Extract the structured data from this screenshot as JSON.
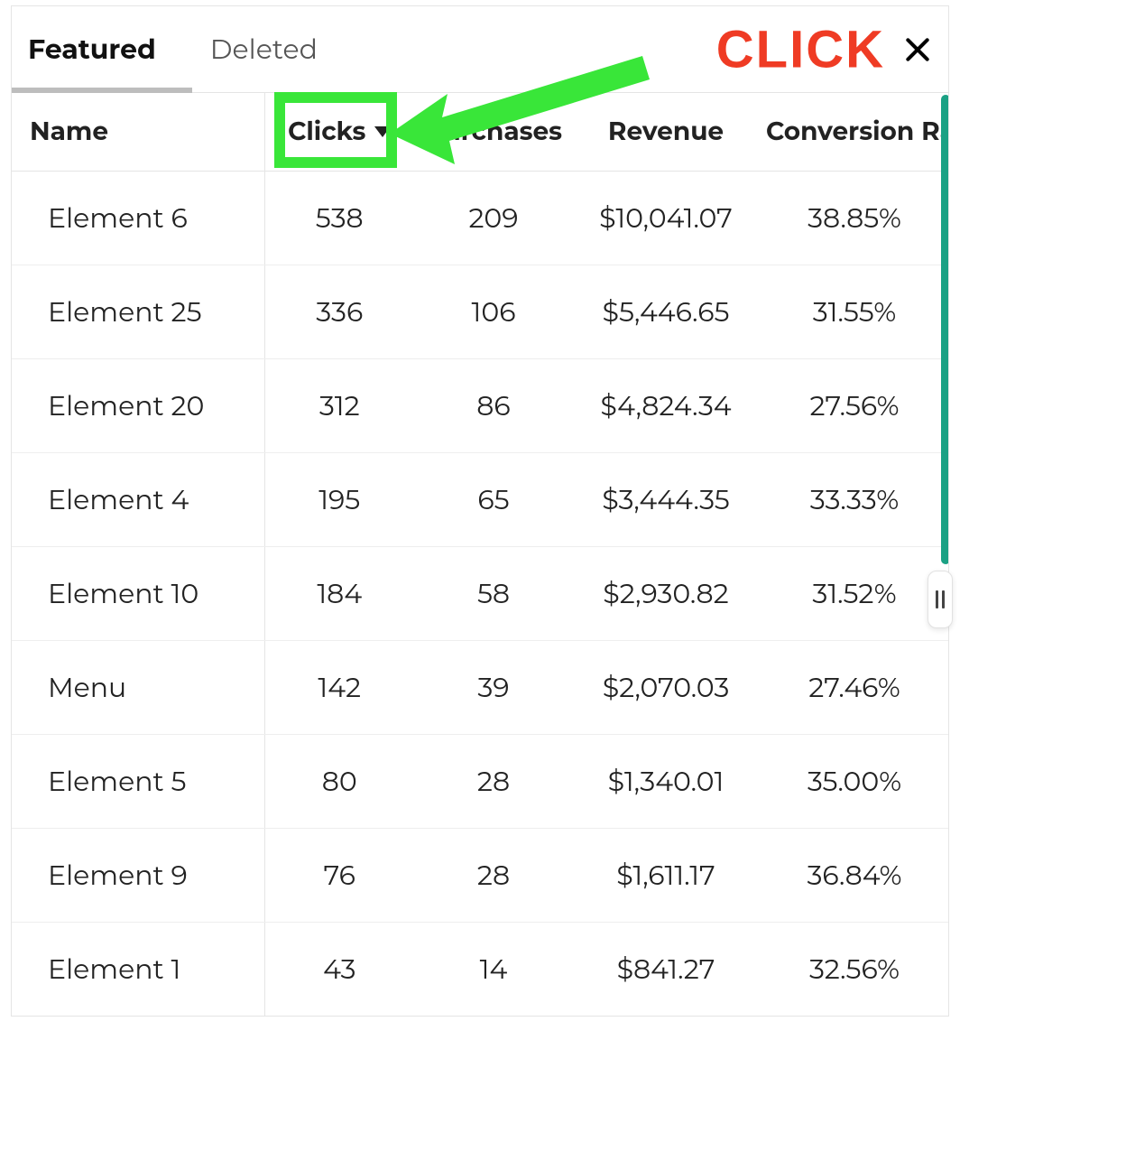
{
  "tabs": {
    "featured": "Featured",
    "deleted": "Deleted"
  },
  "annotation": {
    "click": "CLICK"
  },
  "columns": {
    "name": "Name",
    "clicks": "Clicks",
    "purchases": "Purchases",
    "revenue": "Revenue",
    "conversion": "Conversion Rate"
  },
  "rows": [
    {
      "name": "Element 6",
      "clicks": "538",
      "purchases": "209",
      "revenue": "$10,041.07",
      "conversion": "38.85%"
    },
    {
      "name": "Element 25",
      "clicks": "336",
      "purchases": "106",
      "revenue": "$5,446.65",
      "conversion": "31.55%"
    },
    {
      "name": "Element 20",
      "clicks": "312",
      "purchases": "86",
      "revenue": "$4,824.34",
      "conversion": "27.56%"
    },
    {
      "name": "Element 4",
      "clicks": "195",
      "purchases": "65",
      "revenue": "$3,444.35",
      "conversion": "33.33%"
    },
    {
      "name": "Element 10",
      "clicks": "184",
      "purchases": "58",
      "revenue": "$2,930.82",
      "conversion": "31.52%"
    },
    {
      "name": "Menu",
      "clicks": "142",
      "purchases": "39",
      "revenue": "$2,070.03",
      "conversion": "27.46%"
    },
    {
      "name": "Element 5",
      "clicks": "80",
      "purchases": "28",
      "revenue": "$1,340.01",
      "conversion": "35.00%"
    },
    {
      "name": "Element 9",
      "clicks": "76",
      "purchases": "28",
      "revenue": "$1,611.17",
      "conversion": "36.84%"
    },
    {
      "name": "Element 1",
      "clicks": "43",
      "purchases": "14",
      "revenue": "$841.27",
      "conversion": "32.56%"
    }
  ]
}
